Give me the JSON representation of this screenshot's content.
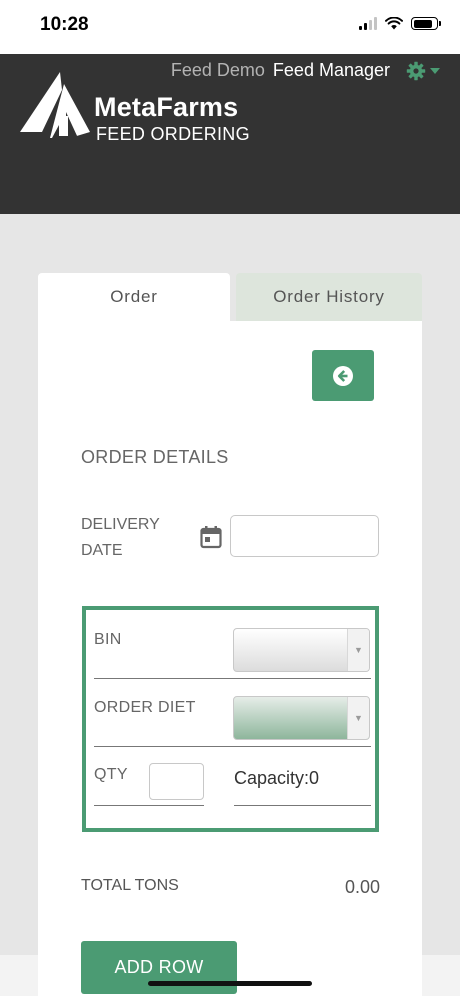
{
  "status_bar": {
    "time": "10:28"
  },
  "header": {
    "org_name": "Feed Demo",
    "role_name": "Feed Manager",
    "brand_name": "MetaFarms",
    "brand_subtitle": "FEED ORDERING",
    "settings_icon": "gear-icon"
  },
  "tabs": [
    {
      "label": "Order",
      "active": true
    },
    {
      "label": "Order History",
      "active": false
    }
  ],
  "form": {
    "back_icon": "arrow-left-circle-icon",
    "section_title": "ORDER DETAILS",
    "delivery_date_label": "DELIVERY DATE",
    "delivery_date_value": "",
    "calendar_icon": "calendar-icon",
    "bin_label": "BIN",
    "bin_value": "",
    "diet_label": "ORDER DIET",
    "diet_value": "",
    "qty_label": "QTY",
    "qty_value": "",
    "capacity_text": "Capacity:0",
    "total_tons_label": "TOTAL TONS",
    "total_tons_value": "0.00",
    "add_row_label": "ADD ROW"
  },
  "colors": {
    "accent": "#4b9b73",
    "header_bg": "#333333",
    "history_tab_bg": "#dde5dc",
    "page_bg": "#e6e6e6"
  }
}
